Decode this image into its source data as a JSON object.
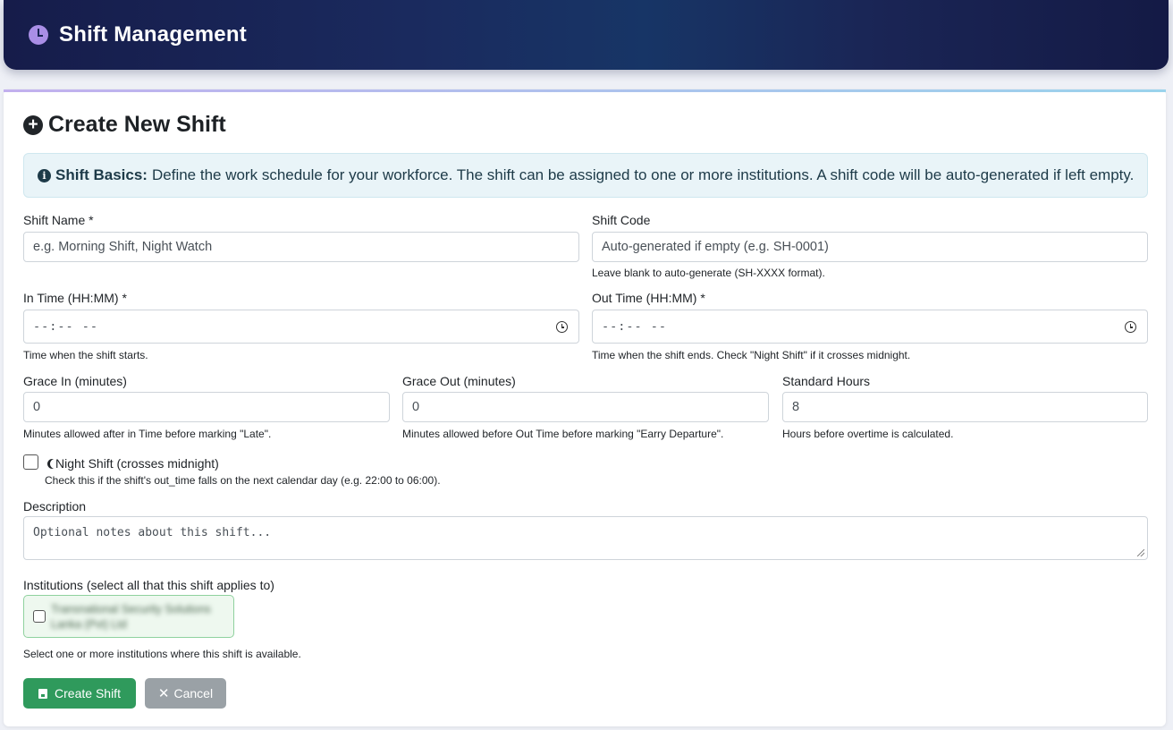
{
  "header": {
    "title": "Shift Management",
    "icon": "clock-icon"
  },
  "card": {
    "title": "Create New Shift",
    "icon": "plus-circle-icon"
  },
  "info": {
    "bold": "Shift Basics:",
    "text": "Define the work schedule for your workforce. The shift can be assigned to one or more institutions. A shift code will be auto-generated if left empty."
  },
  "fields": {
    "shift_name": {
      "label": "Shift Name *",
      "placeholder": "e.g. Morning Shift, Night Watch"
    },
    "shift_code": {
      "label": "Shift Code",
      "placeholder": "Auto-generated if empty (e.g. SH-0001)",
      "help": "Leave blank to auto-generate (SH-XXXX format)."
    },
    "in_time": {
      "label": "In Time (HH:MM) *",
      "value": "--:-- --",
      "help": "Time when the shift starts."
    },
    "out_time": {
      "label": "Out Time (HH:MM) *",
      "value": "--:-- --",
      "help": "Time when the shift ends. Check \"Night Shift\" if it crosses midnight."
    },
    "grace_in": {
      "label": "Grace In (minutes)",
      "value": "0",
      "help": "Minutes allowed after in Time before marking \"Late\"."
    },
    "grace_out": {
      "label": "Grace Out (minutes)",
      "value": "0",
      "help": "Minutes allowed before Out Time before marking \"Earry Departure\"."
    },
    "standard_hours": {
      "label": "Standard Hours",
      "value": "8",
      "help": "Hours before overtime is calculated."
    },
    "night_shift": {
      "label": "Night Shift (crosses midnight)",
      "help": "Check this if the shift's out_time falls on the next calendar day (e.g. 22:00 to 06:00).",
      "checked": false
    },
    "description": {
      "label": "Description",
      "placeholder": "Optional notes about this shift..."
    },
    "institutions": {
      "label": "Institutions (select all that this shift applies to)",
      "items": [
        {
          "name": "Transnational Security Solutions Lanka (Pvt) Ltd",
          "checked": false
        }
      ],
      "help": "Select one or more institutions where this shift is available."
    }
  },
  "actions": {
    "create": "Create Shift",
    "cancel": "Cancel"
  },
  "colors": {
    "header_bg": "#1a2555",
    "primary": "#2f9a5c",
    "secondary": "#9aa1a6",
    "info_bg": "#e9f4f8"
  }
}
